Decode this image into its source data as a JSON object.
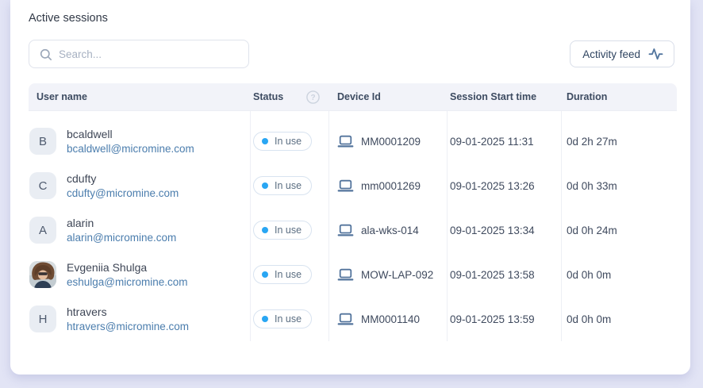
{
  "page": {
    "title": "Active sessions"
  },
  "toolbar": {
    "search": {
      "placeholder": "Search...",
      "icon": "search-icon"
    },
    "activity_feed": {
      "label": "Activity feed",
      "icon": "activity-pulse-icon"
    }
  },
  "table": {
    "columns": [
      {
        "label": "User name"
      },
      {
        "label": "Status",
        "help_icon": "help-circle-icon"
      },
      {
        "label": "Device Id"
      },
      {
        "label": "Session Start time"
      },
      {
        "label": "Duration"
      }
    ],
    "rows": [
      {
        "avatar_type": "initial",
        "initial": "B",
        "name": "bcaldwell",
        "email": "bcaldwell@micromine.com",
        "status": "In use",
        "device_icon": "laptop-icon",
        "device_id": "MM0001209",
        "session_start": "09-01-2025 11:31",
        "duration": "0d 2h 27m"
      },
      {
        "avatar_type": "initial",
        "initial": "C",
        "name": "cdufty",
        "email": "cdufty@micromine.com",
        "status": "In use",
        "device_icon": "laptop-icon",
        "device_id": "mm0001269",
        "session_start": "09-01-2025 13:26",
        "duration": "0d 0h 33m"
      },
      {
        "avatar_type": "initial",
        "initial": "A",
        "name": "alarin",
        "email": "alarin@micromine.com",
        "status": "In use",
        "device_icon": "laptop-icon",
        "device_id": "ala-wks-014",
        "session_start": "09-01-2025 13:34",
        "duration": "0d 0h 24m"
      },
      {
        "avatar_type": "photo",
        "initial": "",
        "name": "Evgeniia Shulga",
        "email": "eshulga@micromine.com",
        "status": "In use",
        "device_icon": "laptop-icon",
        "device_id": "MOW-LAP-092",
        "session_start": "09-01-2025 13:58",
        "duration": "0d 0h 0m"
      },
      {
        "avatar_type": "initial",
        "initial": "H",
        "name": "htravers",
        "email": "htravers@micromine.com",
        "status": "In use",
        "device_icon": "laptop-icon",
        "device_id": "MM0001140",
        "session_start": "09-01-2025 13:59",
        "duration": "0d 0h 0m"
      }
    ]
  },
  "colors": {
    "page_background": "#e2e4f5",
    "card_background": "#ffffff",
    "table_header_background": "#f2f3f9",
    "status_dot": "#29a6f3",
    "email_link": "#4b7dad",
    "laptop_icon": "#53749c",
    "text_primary": "#3e4656",
    "text_header": "#3d4b61"
  }
}
